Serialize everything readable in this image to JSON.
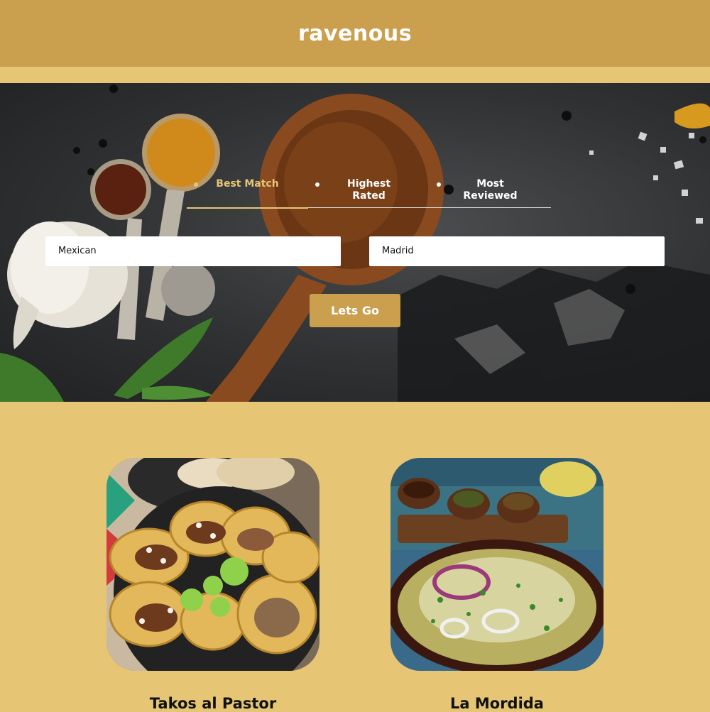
{
  "brand": {
    "name": "ravenous"
  },
  "sort_options": [
    {
      "label": "Best Match",
      "active": true
    },
    {
      "label": "Highest Rated",
      "active": false
    },
    {
      "label": "Most Reviewed",
      "active": false
    }
  ],
  "search": {
    "term_value": "Mexican",
    "location_value": "Madrid"
  },
  "submit": {
    "label": "Lets Go"
  },
  "businesses": [
    {
      "name": "Takos al Pastor"
    },
    {
      "name": "La Mordida"
    }
  ],
  "colors": {
    "navbar": "#CA9F4E",
    "background": "#E6C675",
    "active_tab": "#E6C675",
    "button": "#CA9F4E"
  },
  "icons": {
    "sort_bullet": "dot-icon"
  }
}
